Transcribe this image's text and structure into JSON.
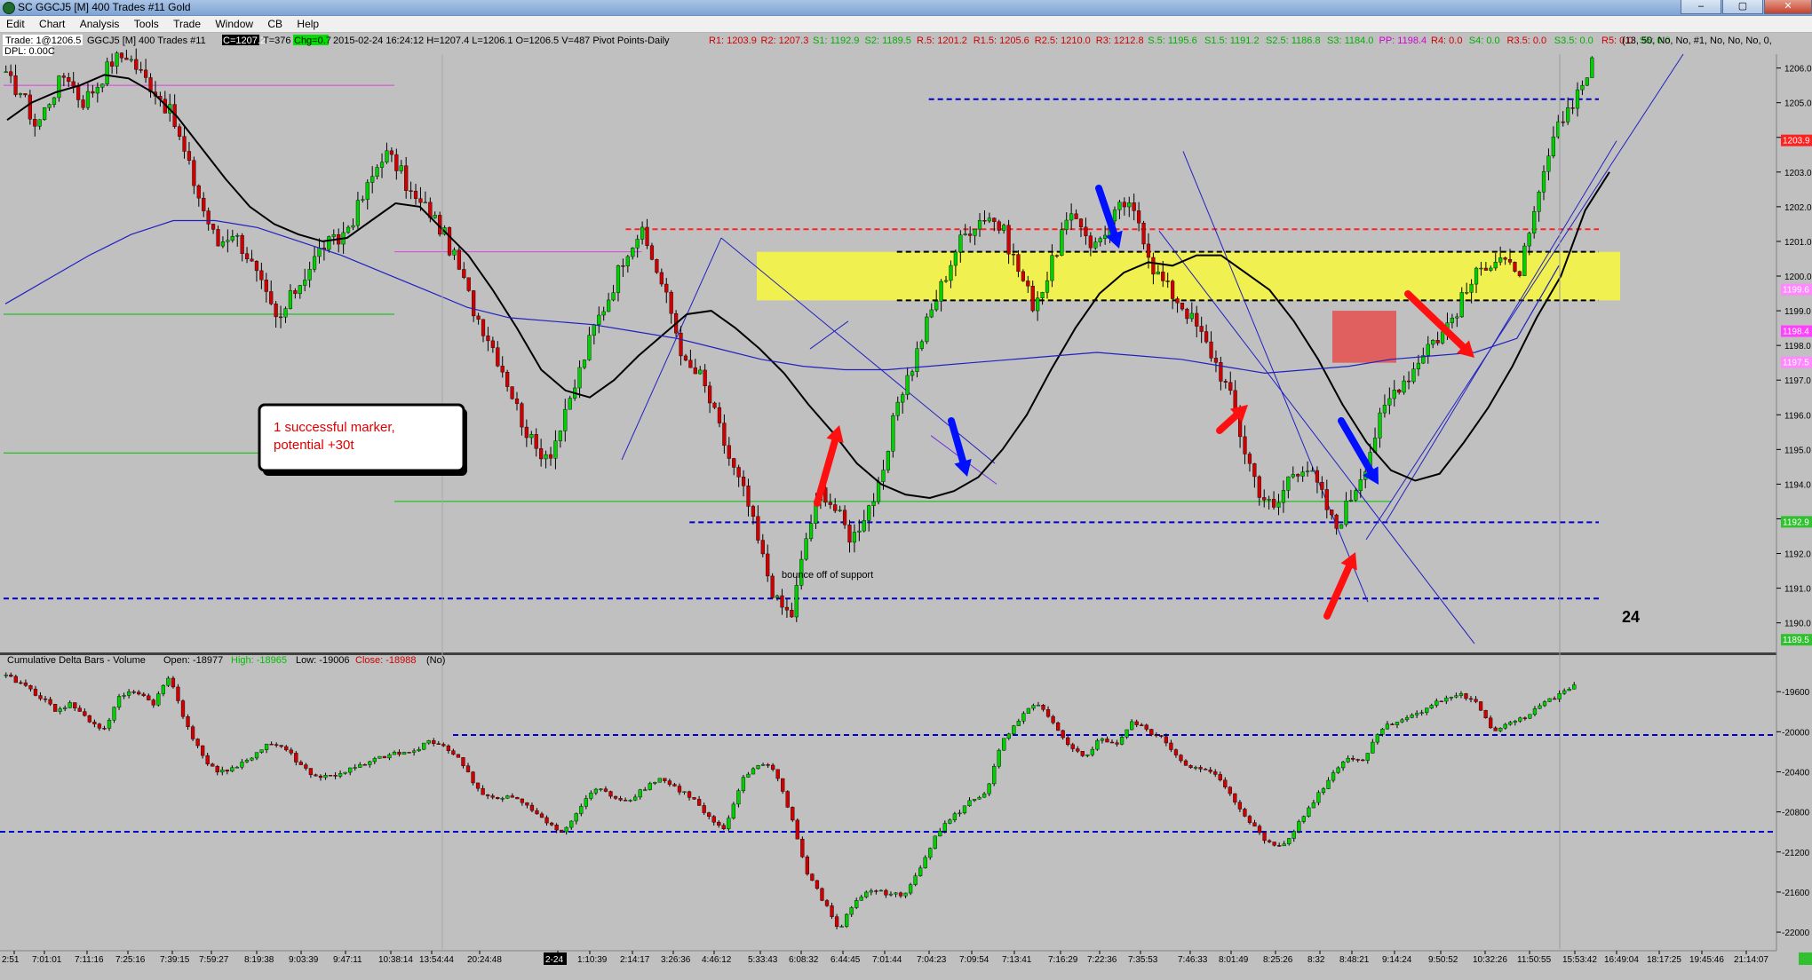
{
  "window": {
    "title": "SC GGCJ5 [M]  400 Trades  #11  Gold",
    "buttons": [
      "–",
      "▢",
      "✕"
    ]
  },
  "menu": [
    "Edit",
    "Chart",
    "Analysis",
    "Tools",
    "Trade",
    "Window",
    "CB",
    "Help"
  ],
  "infobar": {
    "trade": "Trade: 1@1206.5",
    "symbol": "GGCJ5 [M]  400 Trades  #11",
    "close": "C=1207.2",
    "ticks": "T=376",
    "change": "Chg=0.7",
    "ohlc": "2015-02-24 16:24:12  H=1207.4  L=1206.1  O=1206.5  V=487  Pivot Points-Daily",
    "dpl": "DPL: 0.00C",
    "pivots": [
      {
        "t": "R1: 1203.9",
        "c": "#d00000"
      },
      {
        "t": "R2: 1207.3",
        "c": "#d00000"
      },
      {
        "t": "S1: 1192.9",
        "c": "#00b000"
      },
      {
        "t": "S2: 1189.5",
        "c": "#00b000"
      },
      {
        "t": "R.5: 1201.2",
        "c": "#d00000"
      },
      {
        "t": "R1.5: 1205.6",
        "c": "#d00000"
      },
      {
        "t": "R2.5: 1210.0",
        "c": "#d00000"
      },
      {
        "t": "R3: 1212.8",
        "c": "#d00000"
      },
      {
        "t": "S.5: 1195.6",
        "c": "#00b000"
      },
      {
        "t": "S1.5: 1191.2",
        "c": "#00b000"
      },
      {
        "t": "S2.5: 1186.8",
        "c": "#00b000"
      },
      {
        "t": "S3: 1184.0",
        "c": "#00b000"
      },
      {
        "t": "PP: 1198.4",
        "c": "#d000d0"
      },
      {
        "t": "R4: 0.0",
        "c": "#d00000"
      },
      {
        "t": "S4: 0.0",
        "c": "#00b000"
      },
      {
        "t": "R3.5: 0.0",
        "c": "#d00000"
      },
      {
        "t": "S3.5: 0.0",
        "c": "#00b000"
      },
      {
        "t": "R5: 0.0",
        "c": "#d00000"
      },
      {
        "t": "S5: 0.0",
        "c": "#00b000"
      }
    ],
    "params": "(13, 50, No, No, #1, No, No, No, 0,"
  },
  "chart_data": [
    {
      "type": "candlestick",
      "title": "GGCJ5 [M]  400 Trades  #11",
      "ylim": [
        1189.3,
        1206.4
      ],
      "price_ticks": [
        "1206.0",
        "1205.0",
        "1204.0",
        "1203.0",
        "1202.0",
        "1201.0",
        "1200.0",
        "1199.0",
        "1198.0",
        "1197.0",
        "1196.0",
        "1195.0",
        "1194.0",
        "1193.0",
        "1192.0",
        "1191.0",
        "1190.0"
      ],
      "price_tick_values": [
        1206,
        1205,
        1204,
        1203,
        1202,
        1201,
        1200,
        1199,
        1198,
        1197,
        1196,
        1195,
        1194,
        1193,
        1192,
        1191,
        1190
      ],
      "price_markers": [
        {
          "label": "1203.9",
          "value": 1203.9,
          "bg": "#ff2020",
          "fg": "#ffffff"
        },
        {
          "label": "1198.4",
          "value": 1198.4,
          "bg": "#ff40ff",
          "fg": "#ffffff"
        },
        {
          "label": "1197.5",
          "value": 1197.5,
          "bg": "#ff88ff",
          "fg": "#ffffff"
        },
        {
          "label": "1199.6",
          "value": 1199.6,
          "bg": "#ff88ff",
          "fg": "#ffffff"
        },
        {
          "label": "1192.9",
          "value": 1192.9,
          "bg": "#30c030",
          "fg": "#ffffff"
        },
        {
          "label": "1189.5",
          "value": 1189.5,
          "bg": "#30c030",
          "fg": "#ffffff"
        }
      ],
      "close_path": [
        1205.7,
        1205.3,
        1204.3,
        1205.2,
        1205.9,
        1205.0,
        1205.5,
        1206.2,
        1206.4,
        1205.8,
        1205.3,
        1204.6,
        1203.3,
        1202.0,
        1200.9,
        1201.3,
        1200.6,
        1199.6,
        1198.6,
        1199.5,
        1200.2,
        1200.9,
        1201.0,
        1201.7,
        1202.6,
        1203.6,
        1203.1,
        1202.2,
        1201.9,
        1201.2,
        1200.2,
        1199.0,
        1198.2,
        1197.2,
        1196.0,
        1195.0,
        1194.9,
        1195.9,
        1197.3,
        1198.6,
        1199.5,
        1200.7,
        1201.3,
        1200.3,
        1199.0,
        1197.4,
        1197.1,
        1195.9,
        1194.6,
        1193.6,
        1192.0,
        1190.6,
        1190.2,
        1192.5,
        1193.9,
        1193.2,
        1192.4,
        1193.3,
        1194.0,
        1196.4,
        1197.4,
        1198.7,
        1199.8,
        1200.9,
        1201.5,
        1201.8,
        1201.3,
        1200.2,
        1199.2,
        1200.0,
        1201.4,
        1201.7,
        1200.8,
        1201.5,
        1202.1,
        1201.6,
        1200.2,
        1199.6,
        1199.1,
        1198.4,
        1197.6,
        1196.6,
        1195.0,
        1193.8,
        1193.2,
        1194.3,
        1194.6,
        1193.8,
        1192.7,
        1193.6,
        1194.6,
        1195.9,
        1196.8,
        1197.2,
        1198.0,
        1198.3,
        1199.0,
        1199.8,
        1200.4,
        1200.6,
        1199.9,
        1201.3,
        1203.3,
        1204.5,
        1205.3,
        1206.1
      ],
      "sma": {
        "label": "13",
        "values": [
          1204.5,
          1205.0,
          1205.3,
          1205.5,
          1205.8,
          1205.7,
          1205.3,
          1204.6,
          1203.7,
          1202.8,
          1202.0,
          1201.5,
          1201.2,
          1201.0,
          1201.1,
          1201.6,
          1202.1,
          1202.0,
          1201.3,
          1200.6,
          1199.6,
          1198.5,
          1197.3,
          1196.7,
          1196.5,
          1197.0,
          1197.7,
          1198.3,
          1198.9,
          1199.0,
          1198.5,
          1197.9,
          1197.2,
          1196.3,
          1195.5,
          1194.6,
          1194.0,
          1193.7,
          1193.6,
          1193.8,
          1194.2,
          1195.0,
          1196.0,
          1197.3,
          1198.5,
          1199.5,
          1200.1,
          1200.4,
          1200.3,
          1200.6,
          1200.6,
          1200.1,
          1199.6,
          1198.7,
          1197.6,
          1196.3,
          1195.2,
          1194.4,
          1194.1,
          1194.3,
          1195.2,
          1196.2,
          1197.4,
          1198.8,
          1200.0,
          1201.9,
          1203.0
        ]
      },
      "sma_slow": {
        "label": "50",
        "values": [
          1199.2,
          1199.9,
          1200.6,
          1201.2,
          1201.6,
          1201.6,
          1201.4,
          1201.0,
          1200.6,
          1200.1,
          1199.6,
          1199.1,
          1198.8,
          1198.7,
          1198.6,
          1198.4,
          1198.2,
          1197.9,
          1197.6,
          1197.4,
          1197.3,
          1197.3,
          1197.4,
          1197.5,
          1197.6,
          1197.7,
          1197.8,
          1197.7,
          1197.6,
          1197.4,
          1197.2,
          1197.3,
          1197.4,
          1197.6,
          1197.7,
          1197.8,
          1198.2,
          1200.3
        ]
      },
      "hlines": [
        {
          "value": 1205.1,
          "color": "#0000cc",
          "dash": true,
          "from": 0.58,
          "to": 1.0
        },
        {
          "value": 1201.35,
          "color": "#ff2020",
          "dash": true,
          "from": 0.39,
          "to": 1.0
        },
        {
          "value": 1200.7,
          "color": "#000000",
          "dash": true,
          "from": 0.56,
          "to": 1.0
        },
        {
          "value": 1199.3,
          "color": "#000000",
          "dash": true,
          "from": 0.56,
          "to": 1.0
        },
        {
          "value": 1192.9,
          "color": "#0000cc",
          "dash": true,
          "from": 0.43,
          "to": 1.0
        },
        {
          "value": 1190.7,
          "color": "#0000cc",
          "dash": true,
          "from": 0.0,
          "to": 1.0
        },
        {
          "value": 1198.9,
          "color": "#00c000",
          "dash": false,
          "from": 0.0,
          "to": 0.245
        },
        {
          "value": 1194.9,
          "color": "#00c000",
          "dash": false,
          "from": 0.0,
          "to": 0.245
        },
        {
          "value": 1193.5,
          "color": "#00c000",
          "dash": false,
          "from": 0.245,
          "to": 0.87
        },
        {
          "value": 1205.5,
          "color": "#e040e0",
          "dash": false,
          "from": 0.0,
          "to": 0.245
        },
        {
          "value": 1200.7,
          "color": "#e040e0",
          "dash": false,
          "from": 0.245,
          "to": 0.4
        }
      ],
      "annotations": [
        {
          "text": "1 successful marker, potential +30t"
        },
        {
          "text": "bounce off of support"
        },
        {
          "text": "24"
        }
      ]
    },
    {
      "type": "candlestick",
      "title": "Cumulative Delta Bars - Volume",
      "legend": {
        "open": "Open: -18977",
        "high": "High: -18965",
        "low": "Low: -19006",
        "close": "Close: -18988",
        "tail": "(No)"
      },
      "ylim": [
        -22150,
        -19350
      ],
      "ticks": [
        "-19600",
        "-20000",
        "-20400",
        "-20800",
        "-21200",
        "-21600",
        "-22000"
      ],
      "tick_values": [
        -19600,
        -20000,
        -20400,
        -20800,
        -21200,
        -21600,
        -22000
      ],
      "close_path": [
        -19450,
        -19520,
        -19640,
        -19780,
        -19720,
        -19880,
        -19980,
        -19640,
        -19590,
        -19720,
        -19450,
        -19900,
        -20250,
        -20400,
        -20380,
        -20250,
        -20120,
        -20150,
        -20330,
        -20450,
        -20440,
        -20380,
        -20330,
        -20250,
        -20220,
        -20200,
        -20080,
        -20160,
        -20330,
        -20600,
        -20680,
        -20650,
        -20760,
        -20870,
        -21020,
        -20800,
        -20560,
        -20630,
        -20690,
        -20570,
        -20460,
        -20560,
        -20660,
        -20860,
        -21000,
        -20500,
        -20320,
        -20360,
        -20800,
        -21400,
        -21680,
        -21980,
        -21680,
        -21580,
        -21610,
        -21650,
        -21330,
        -21000,
        -20850,
        -20700,
        -20600,
        -20100,
        -19900,
        -19700,
        -19900,
        -20150,
        -20250,
        -20070,
        -20120,
        -19900,
        -20000,
        -20100,
        -20300,
        -20380,
        -20420,
        -20650,
        -20860,
        -21080,
        -21150,
        -20950,
        -20700,
        -20470,
        -20250,
        -20300,
        -20000,
        -19900,
        -19850,
        -19750,
        -19680,
        -19620,
        -19720,
        -20000,
        -19900,
        -19850,
        -19720,
        -19650,
        -19530
      ]
    }
  ],
  "time_axis": [
    {
      "label": "2:51",
      "hl": false
    },
    {
      "label": "7:01:01",
      "hl": false
    },
    {
      "label": "7:11:16",
      "hl": false
    },
    {
      "label": "7:25:16",
      "hl": false
    },
    {
      "label": "7:39:15",
      "hl": false
    },
    {
      "label": "7:59:27",
      "hl": false
    },
    {
      "label": "8:19:38",
      "hl": false
    },
    {
      "label": "9:03:39",
      "hl": false
    },
    {
      "label": "9:47:11",
      "hl": false
    },
    {
      "label": "10:38:14",
      "hl": false
    },
    {
      "label": "13:54:44",
      "hl": false
    },
    {
      "label": "20:24:48",
      "hl": false
    },
    {
      "label": "2-24",
      "hl": true
    },
    {
      "label": "1:10:39",
      "hl": false
    },
    {
      "label": "2:14:17",
      "hl": false
    },
    {
      "label": "3:26:36",
      "hl": false
    },
    {
      "label": "4:46:12",
      "hl": false
    },
    {
      "label": "5:33:43",
      "hl": false
    },
    {
      "label": "6:08:32",
      "hl": false
    },
    {
      "label": "6:44:45",
      "hl": false
    },
    {
      "label": "7:01:44",
      "hl": false
    },
    {
      "label": "7:04:23",
      "hl": false
    },
    {
      "label": "7:09:54",
      "hl": false
    },
    {
      "label": "7:13:41",
      "hl": false
    },
    {
      "label": "7:16:29",
      "hl": false
    },
    {
      "label": "7:22:36",
      "hl": false
    },
    {
      "label": "7:35:53",
      "hl": false
    },
    {
      "label": "7:46:33",
      "hl": false
    },
    {
      "label": "8:01:49",
      "hl": false
    },
    {
      "label": "8:25:26",
      "hl": false
    },
    {
      "label": "8:32",
      "hl": false
    },
    {
      "label": "8:48:21",
      "hl": false
    },
    {
      "label": "9:14:24",
      "hl": false
    },
    {
      "label": "9:50:52",
      "hl": false
    },
    {
      "label": "10:32:26",
      "hl": false
    },
    {
      "label": "11:50:55",
      "hl": false
    },
    {
      "label": "15:53:42",
      "hl": false
    },
    {
      "label": "16:49:04",
      "hl": false
    },
    {
      "label": "18:17:25",
      "hl": false
    },
    {
      "label": "19:45:46",
      "hl": false
    },
    {
      "label": "21:14:07",
      "hl": false
    }
  ],
  "colors": {
    "background": "#c0c0c0",
    "up": "#00d000",
    "down": "#d00000",
    "sma_fast": "#000000",
    "sma_slow": "#2020c0",
    "zone": "#f0f050",
    "box": "#e06060",
    "arrow_red": "#ff1010",
    "arrow_blue": "#0010ff"
  }
}
